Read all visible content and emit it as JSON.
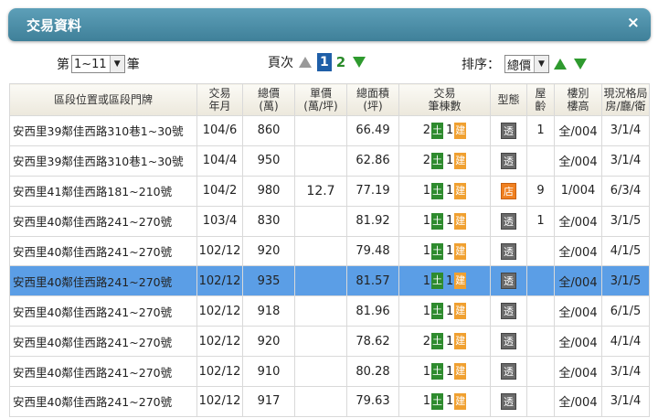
{
  "dialog": {
    "title": "交易資料",
    "close_icon": "×"
  },
  "toolbar": {
    "page_prefix": "第",
    "page_select_value": "1~11",
    "page_suffix": "筆",
    "pager_label": "頁次",
    "pages": [
      "1",
      "2"
    ],
    "current_page": "1",
    "sort_label": "排序：",
    "sort_select_value": "總價"
  },
  "colors": {
    "titlebar": "#4a8ea7",
    "selected_row": "#5b9ee6",
    "land_badge": "#2e8b2e",
    "building_badge": "#f0a030",
    "shop_badge": "#f08020",
    "transparent_badge": "#6a6a6a"
  },
  "table": {
    "headers": {
      "address": "區段位置或區段門牌",
      "date_l1": "交易",
      "date_l2": "年月",
      "total_l1": "總價",
      "total_l2": "(萬)",
      "unit_l1": "單價",
      "unit_l2": "(萬/坪)",
      "area_l1": "總面積",
      "area_l2": "(坪)",
      "count_l1": "交易",
      "count_l2": "筆棟數",
      "type": "型態",
      "age_l1": "屋",
      "age_l2": "齡",
      "floor_l1": "樓別",
      "floor_l2": "樓高",
      "layout_l1": "現況格局",
      "layout_l2": "房/廳/衛"
    },
    "land_label": "土",
    "building_label": "建",
    "rows": [
      {
        "address": "安西里39鄰佳西路310巷1~30號",
        "date": "104/6",
        "total": "860",
        "unit": "",
        "area": "66.49",
        "land": "2",
        "building": "1",
        "type": "透",
        "age": "1",
        "floor": "全/004",
        "layout": "3/1/4"
      },
      {
        "address": "安西里39鄰佳西路310巷1~30號",
        "date": "104/4",
        "total": "950",
        "unit": "",
        "area": "62.86",
        "land": "2",
        "building": "1",
        "type": "透",
        "age": "",
        "floor": "全/004",
        "layout": "3/1/4"
      },
      {
        "address": "安西里41鄰佳西路181~210號",
        "date": "104/2",
        "total": "980",
        "unit": "12.7",
        "area": "77.19",
        "land": "1",
        "building": "1",
        "type": "店",
        "age": "9",
        "floor": "1/004",
        "layout": "6/3/4"
      },
      {
        "address": "安西里40鄰佳西路241~270號",
        "date": "103/4",
        "total": "830",
        "unit": "",
        "area": "81.92",
        "land": "1",
        "building": "1",
        "type": "透",
        "age": "1",
        "floor": "全/004",
        "layout": "3/1/5"
      },
      {
        "address": "安西里40鄰佳西路241~270號",
        "date": "102/12",
        "total": "920",
        "unit": "",
        "area": "79.48",
        "land": "1",
        "building": "1",
        "type": "透",
        "age": "",
        "floor": "全/004",
        "layout": "4/1/5"
      },
      {
        "address": "安西里40鄰佳西路241~270號",
        "date": "102/12",
        "total": "935",
        "unit": "",
        "area": "81.57",
        "land": "1",
        "building": "1",
        "type": "透",
        "age": "",
        "floor": "全/004",
        "layout": "3/1/5"
      },
      {
        "address": "安西里40鄰佳西路241~270號",
        "date": "102/12",
        "total": "918",
        "unit": "",
        "area": "81.96",
        "land": "1",
        "building": "1",
        "type": "透",
        "age": "",
        "floor": "全/004",
        "layout": "6/1/5"
      },
      {
        "address": "安西里40鄰佳西路241~270號",
        "date": "102/12",
        "total": "920",
        "unit": "",
        "area": "78.62",
        "land": "2",
        "building": "1",
        "type": "透",
        "age": "",
        "floor": "全/004",
        "layout": "4/1/4"
      },
      {
        "address": "安西里40鄰佳西路241~270號",
        "date": "102/12",
        "total": "910",
        "unit": "",
        "area": "80.28",
        "land": "1",
        "building": "1",
        "type": "透",
        "age": "",
        "floor": "全/004",
        "layout": "3/1/4"
      },
      {
        "address": "安西里40鄰佳西路241~270號",
        "date": "102/12",
        "total": "917",
        "unit": "",
        "area": "79.63",
        "land": "1",
        "building": "1",
        "type": "透",
        "age": "",
        "floor": "全/004",
        "layout": "3/1/4"
      }
    ]
  }
}
